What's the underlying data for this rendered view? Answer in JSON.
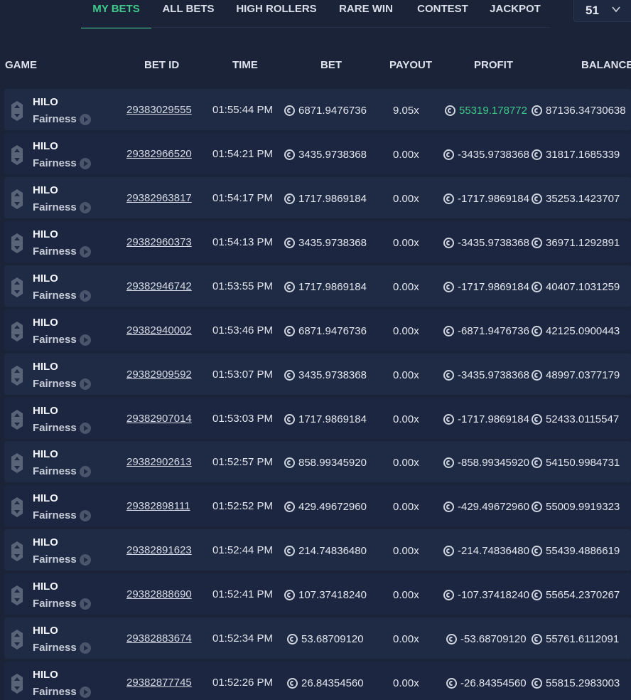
{
  "tabs": [
    {
      "label": "MY BETS",
      "active": true
    },
    {
      "label": "ALL BETS",
      "active": false
    },
    {
      "label": "HIGH ROLLERS",
      "active": false
    },
    {
      "label": "RARE WIN",
      "active": false
    },
    {
      "label": "CONTEST",
      "active": false
    },
    {
      "label": "JACKPOT",
      "active": false
    }
  ],
  "count_select": {
    "value": "51"
  },
  "columns": [
    "GAME",
    "BET ID",
    "TIME",
    "BET",
    "PAYOUT",
    "PROFIT",
    "BALANCE"
  ],
  "colors": {
    "accent": "#3fc98a",
    "background": "#1a2338",
    "row": "#1f2a44"
  },
  "icons": {
    "game": "hilo-hexagon-icon",
    "fairness": "play-icon",
    "currency": "coin-icon",
    "dropdown": "chevron-down-icon"
  },
  "rows": [
    {
      "game": "HILO",
      "fairness": "Fairness",
      "bet_id": "29383029555",
      "time": "01:55:44 PM",
      "bet": "6871.9476736",
      "payout": "9.05x",
      "profit": "55319.178772",
      "balance": "87136.34730638",
      "win": true
    },
    {
      "game": "HILO",
      "fairness": "Fairness",
      "bet_id": "29382966520",
      "time": "01:54:21 PM",
      "bet": "3435.9738368",
      "payout": "0.00x",
      "profit": "-3435.9738368",
      "balance": "31817.1685339",
      "win": false
    },
    {
      "game": "HILO",
      "fairness": "Fairness",
      "bet_id": "29382963817",
      "time": "01:54:17 PM",
      "bet": "1717.9869184",
      "payout": "0.00x",
      "profit": "-1717.9869184",
      "balance": "35253.1423707",
      "win": false
    },
    {
      "game": "HILO",
      "fairness": "Fairness",
      "bet_id": "29382960373",
      "time": "01:54:13 PM",
      "bet": "3435.9738368",
      "payout": "0.00x",
      "profit": "-3435.9738368",
      "balance": "36971.1292891",
      "win": false
    },
    {
      "game": "HILO",
      "fairness": "Fairness",
      "bet_id": "29382946742",
      "time": "01:53:55 PM",
      "bet": "1717.9869184",
      "payout": "0.00x",
      "profit": "-1717.9869184",
      "balance": "40407.1031259",
      "win": false
    },
    {
      "game": "HILO",
      "fairness": "Fairness",
      "bet_id": "29382940002",
      "time": "01:53:46 PM",
      "bet": "6871.9476736",
      "payout": "0.00x",
      "profit": "-6871.9476736",
      "balance": "42125.0900443",
      "win": false
    },
    {
      "game": "HILO",
      "fairness": "Fairness",
      "bet_id": "29382909592",
      "time": "01:53:07 PM",
      "bet": "3435.9738368",
      "payout": "0.00x",
      "profit": "-3435.9738368",
      "balance": "48997.0377179",
      "win": false
    },
    {
      "game": "HILO",
      "fairness": "Fairness",
      "bet_id": "29382907014",
      "time": "01:53:03 PM",
      "bet": "1717.9869184",
      "payout": "0.00x",
      "profit": "-1717.9869184",
      "balance": "52433.0115547",
      "win": false
    },
    {
      "game": "HILO",
      "fairness": "Fairness",
      "bet_id": "29382902613",
      "time": "01:52:57 PM",
      "bet": "858.99345920",
      "payout": "0.00x",
      "profit": "-858.99345920",
      "balance": "54150.9984731",
      "win": false
    },
    {
      "game": "HILO",
      "fairness": "Fairness",
      "bet_id": "29382898111",
      "time": "01:52:52 PM",
      "bet": "429.49672960",
      "payout": "0.00x",
      "profit": "-429.49672960",
      "balance": "55009.9919323",
      "win": false
    },
    {
      "game": "HILO",
      "fairness": "Fairness",
      "bet_id": "29382891623",
      "time": "01:52:44 PM",
      "bet": "214.74836480",
      "payout": "0.00x",
      "profit": "-214.74836480",
      "balance": "55439.4886619",
      "win": false
    },
    {
      "game": "HILO",
      "fairness": "Fairness",
      "bet_id": "29382888690",
      "time": "01:52:41 PM",
      "bet": "107.37418240",
      "payout": "0.00x",
      "profit": "-107.37418240",
      "balance": "55654.2370267",
      "win": false
    },
    {
      "game": "HILO",
      "fairness": "Fairness",
      "bet_id": "29382883674",
      "time": "01:52:34 PM",
      "bet": "53.68709120",
      "payout": "0.00x",
      "profit": "-53.68709120",
      "balance": "55761.6112091",
      "win": false
    },
    {
      "game": "HILO",
      "fairness": "Fairness",
      "bet_id": "29382877745",
      "time": "01:52:26 PM",
      "bet": "26.84354560",
      "payout": "0.00x",
      "profit": "-26.84354560",
      "balance": "55815.2983003",
      "win": false
    }
  ]
}
